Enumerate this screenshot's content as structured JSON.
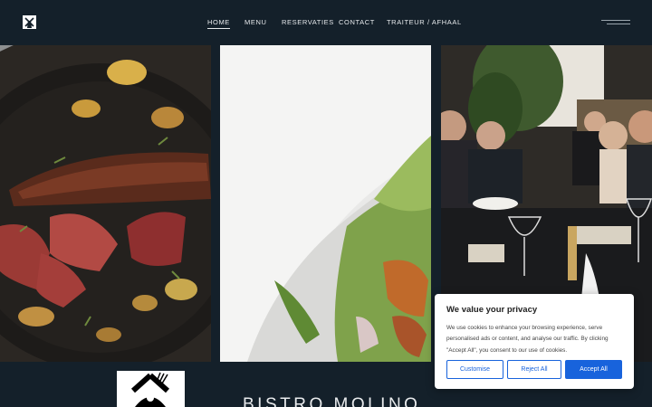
{
  "nav": {
    "items": [
      {
        "label": "HOME",
        "active": true
      },
      {
        "label": "MENU",
        "active": false
      },
      {
        "label": "RESERVATIES",
        "active": false
      },
      {
        "label": "CONTACT",
        "active": false
      },
      {
        "label": "TRAITEUR / AFHAAL",
        "active": false
      }
    ]
  },
  "icons": {
    "logo": "windmill-icon",
    "menu_toggle": "hamburger-menu-icon",
    "brand_logo": "windmill-fork-knife-logo"
  },
  "gallery": [
    {
      "name": "steak-with-mushrooms-photo"
    },
    {
      "name": "salad-closeup-photo"
    },
    {
      "name": "restaurant-dining-photo"
    }
  ],
  "brand": {
    "title": "BISTRO MOLINO"
  },
  "cookie": {
    "title": "We value your privacy",
    "text": "We use cookies to enhance your browsing experience, serve personalised ads or content, and analyse our traffic. By clicking \"Accept All\", you consent to our use of cookies.",
    "customise_label": "Customise",
    "reject_label": "Reject All",
    "accept_label": "Accept All"
  },
  "colors": {
    "background": "#14202a",
    "accent": "#1863dc"
  }
}
